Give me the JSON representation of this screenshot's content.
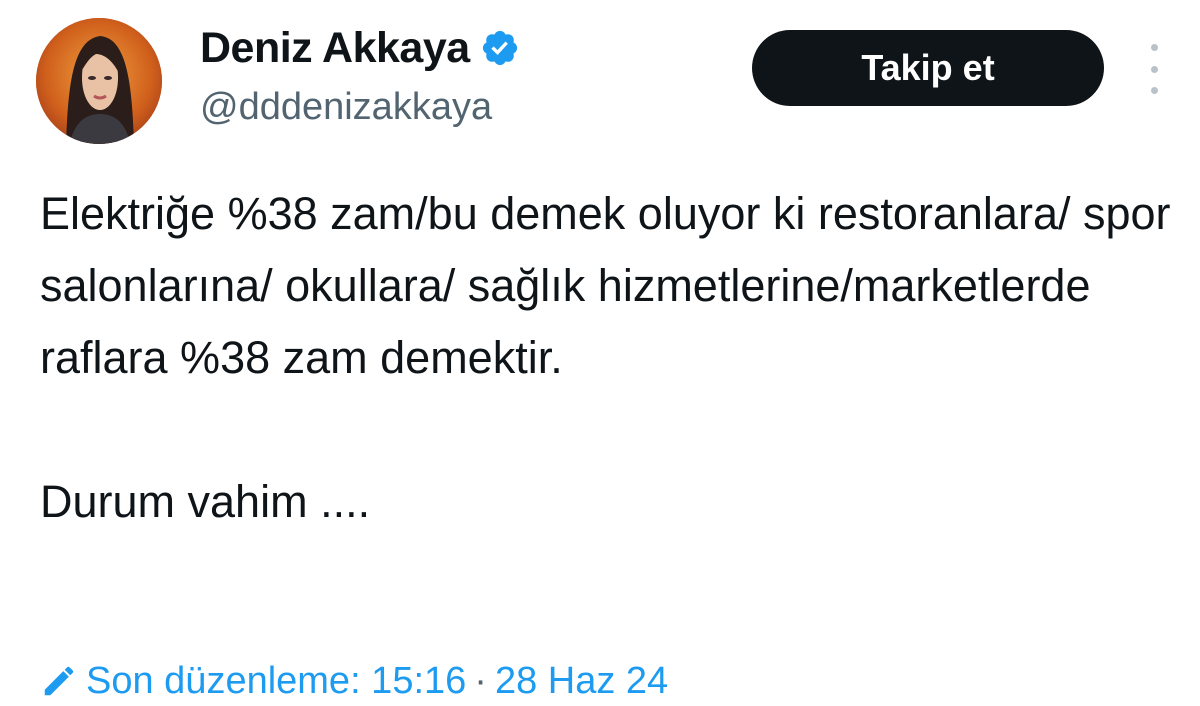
{
  "author": {
    "display_name": "Deniz Akkaya",
    "handle": "@dddenizakkaya",
    "verified_icon": "verified-badge-icon",
    "avatar_icon": "profile-avatar"
  },
  "actions": {
    "follow_label": "Takip et",
    "more_icon": "more-vertical-icon"
  },
  "tweet": {
    "body": "Elektriğe %38 zam/bu demek oluyor ki restoranlara/ spor salonlarına/ okullara/ sağlık hizmetlerine/marketlerde raflara %38 zam demektir.",
    "closing": "Durum vahim ...."
  },
  "meta": {
    "edit_icon": "pencil-icon",
    "edited_label": "Son düzenleme: 15:16",
    "separator": "·",
    "date": "28 Haz 24"
  },
  "colors": {
    "accent": "#1d9bf0",
    "text": "#0f1419",
    "secondary": "#536471",
    "button_bg": "#0f1419",
    "button_text": "#ffffff"
  }
}
